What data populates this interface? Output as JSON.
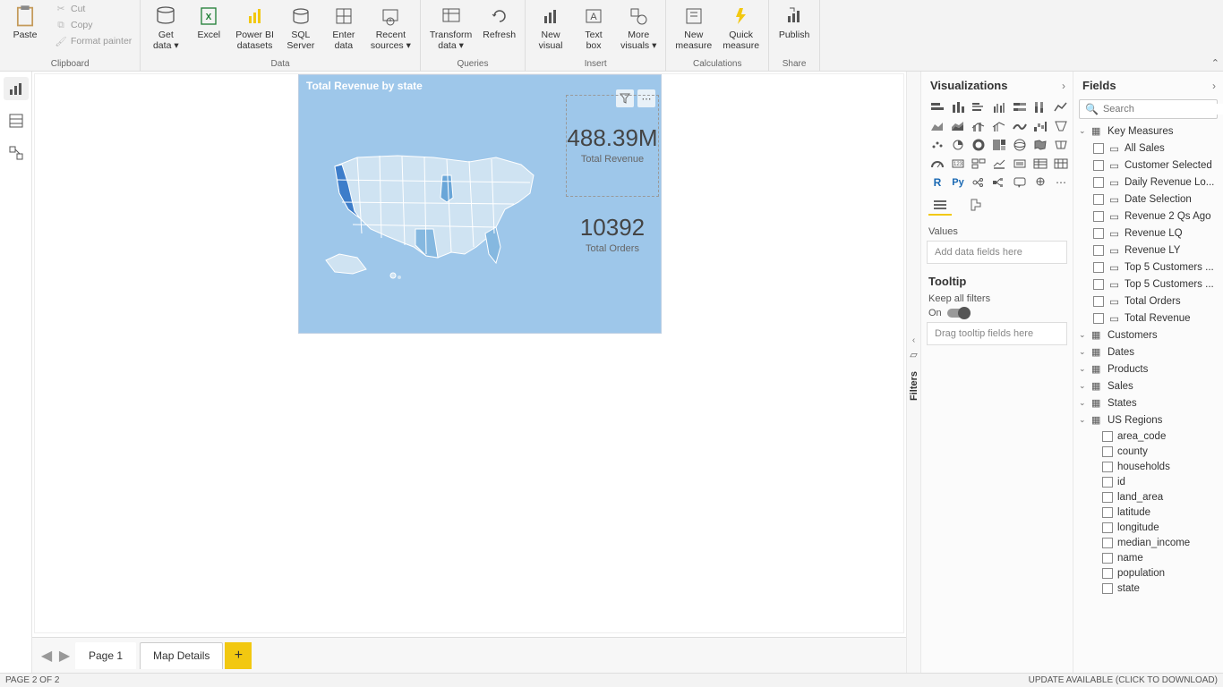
{
  "ribbon": {
    "clipboard": {
      "label": "Clipboard",
      "paste": "Paste",
      "cut": "Cut",
      "copy": "Copy",
      "fmt": "Format painter"
    },
    "data": {
      "label": "Data",
      "getdata": "Get\ndata ▾",
      "excel": "Excel",
      "pbids": "Power BI\ndatasets",
      "sql": "SQL\nServer",
      "enter": "Enter\ndata",
      "recent": "Recent\nsources ▾"
    },
    "queries": {
      "label": "Queries",
      "transform": "Transform\ndata ▾",
      "refresh": "Refresh"
    },
    "insert": {
      "label": "Insert",
      "newvis": "New\nvisual",
      "textbox": "Text\nbox",
      "more": "More\nvisuals ▾"
    },
    "calc": {
      "label": "Calculations",
      "newmeas": "New\nmeasure",
      "quickmeas": "Quick\nmeasure"
    },
    "share": {
      "label": "Share",
      "publish": "Publish"
    }
  },
  "canvas": {
    "visual_title": "Total Revenue by state",
    "kpi1_val": "488.39M",
    "kpi1_lbl": "Total Revenue",
    "kpi2_val": "10392",
    "kpi2_lbl": "Total Orders"
  },
  "tabs": {
    "page1": "Page 1",
    "page2": "Map Details"
  },
  "filters_label": "Filters",
  "viz": {
    "title": "Visualizations",
    "values": "Values",
    "values_ph": "Add data fields here",
    "tooltip": "Tooltip",
    "keep": "Keep all filters",
    "on": "On",
    "tooltip_ph": "Drag tooltip fields here"
  },
  "fields": {
    "title": "Fields",
    "search_ph": "Search",
    "tables": {
      "key": "Key Measures",
      "key_fields": [
        "All Sales",
        "Customer Selected",
        "Daily Revenue Lo...",
        "Date Selection",
        "Revenue 2 Qs Ago",
        "Revenue LQ",
        "Revenue LY",
        "Top 5 Customers ...",
        "Top 5 Customers ...",
        "Total Orders",
        "Total Revenue"
      ],
      "customers": "Customers",
      "dates": "Dates",
      "products": "Products",
      "sales": "Sales",
      "states": "States",
      "usregions": "US Regions",
      "usregions_fields": [
        "area_code",
        "county",
        "households",
        "id",
        "land_area",
        "latitude",
        "longitude",
        "median_income",
        "name",
        "population",
        "state"
      ]
    }
  },
  "status": {
    "page": "PAGE 2 OF 2",
    "update": "UPDATE AVAILABLE (CLICK TO DOWNLOAD)"
  }
}
